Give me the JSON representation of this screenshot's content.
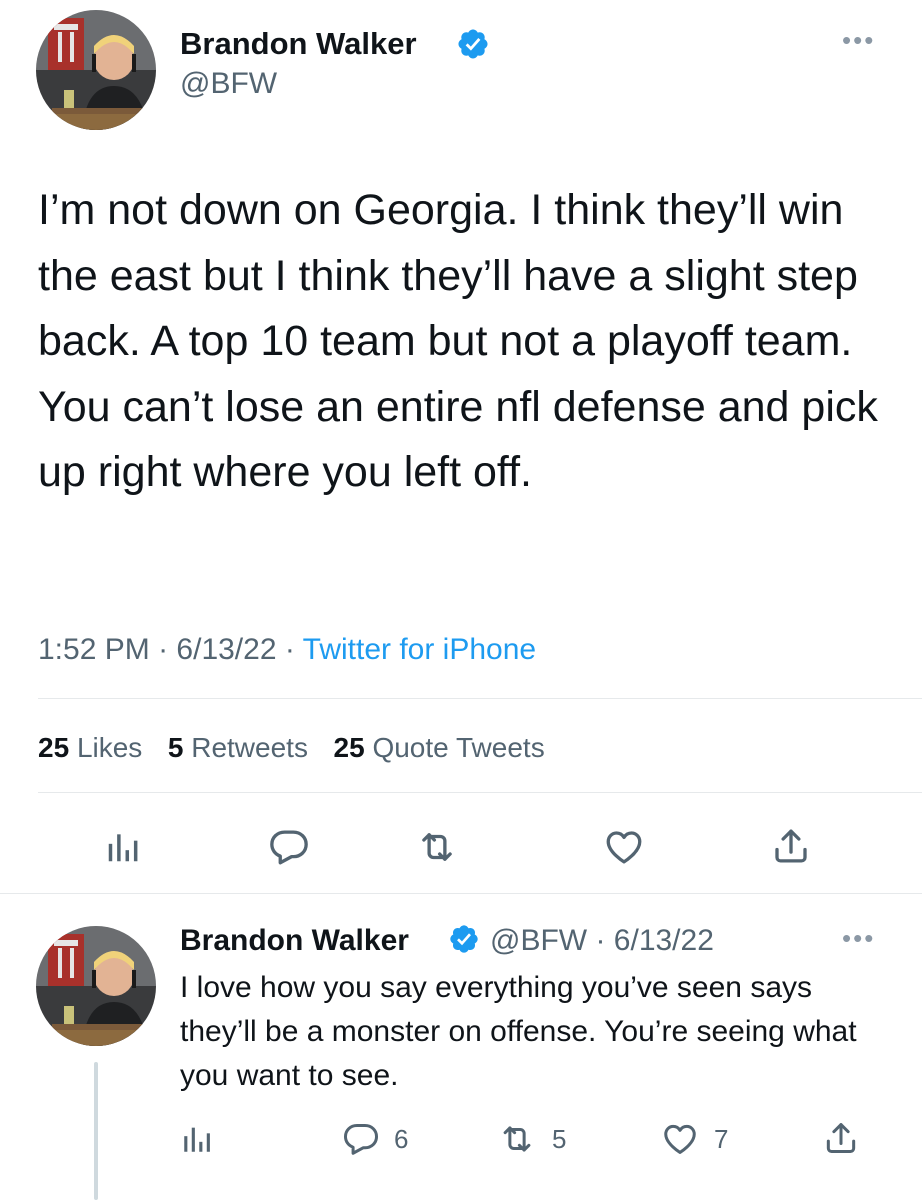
{
  "main_tweet": {
    "author_name": "Brandon Walker",
    "handle": "@BFW",
    "text": "I’m not down on Georgia. I think they’ll win the east but I think they’ll have a slight step back. A top 10 team but not a playoff team. You can’t lose an entire nfl defense and pick up right where you left off.",
    "time": "1:52 PM",
    "date": "6/13/22",
    "source": "Twitter for iPhone",
    "stats": {
      "likes_count": "25",
      "likes_label": "Likes",
      "retweets_count": "5",
      "retweets_label": "Retweets",
      "quotes_count": "25",
      "quotes_label": "Quote Tweets"
    },
    "more_label": "•••"
  },
  "reply_tweet": {
    "author_name": "Brandon Walker",
    "handle": "@BFW",
    "date": "6/13/22",
    "text": "I love how you say everything you’ve seen says they’ll be a monster on offense. You’re seeing what you want to see.",
    "reply_count": "6",
    "retweet_count": "5",
    "like_count": "7",
    "more_label": "•••"
  },
  "separator": "·",
  "colors": {
    "text": "#0f1419",
    "secondary": "#536471",
    "accent_blue": "#1d9bf0",
    "divider": "#e6e9eb",
    "verified_badge": "#1d9bf0"
  },
  "icons": {
    "verified": "verified-badge-icon",
    "analytics": "analytics-icon",
    "reply": "reply-icon",
    "retweet": "retweet-icon",
    "like": "heart-icon",
    "share": "share-icon",
    "more": "more-options-icon"
  }
}
